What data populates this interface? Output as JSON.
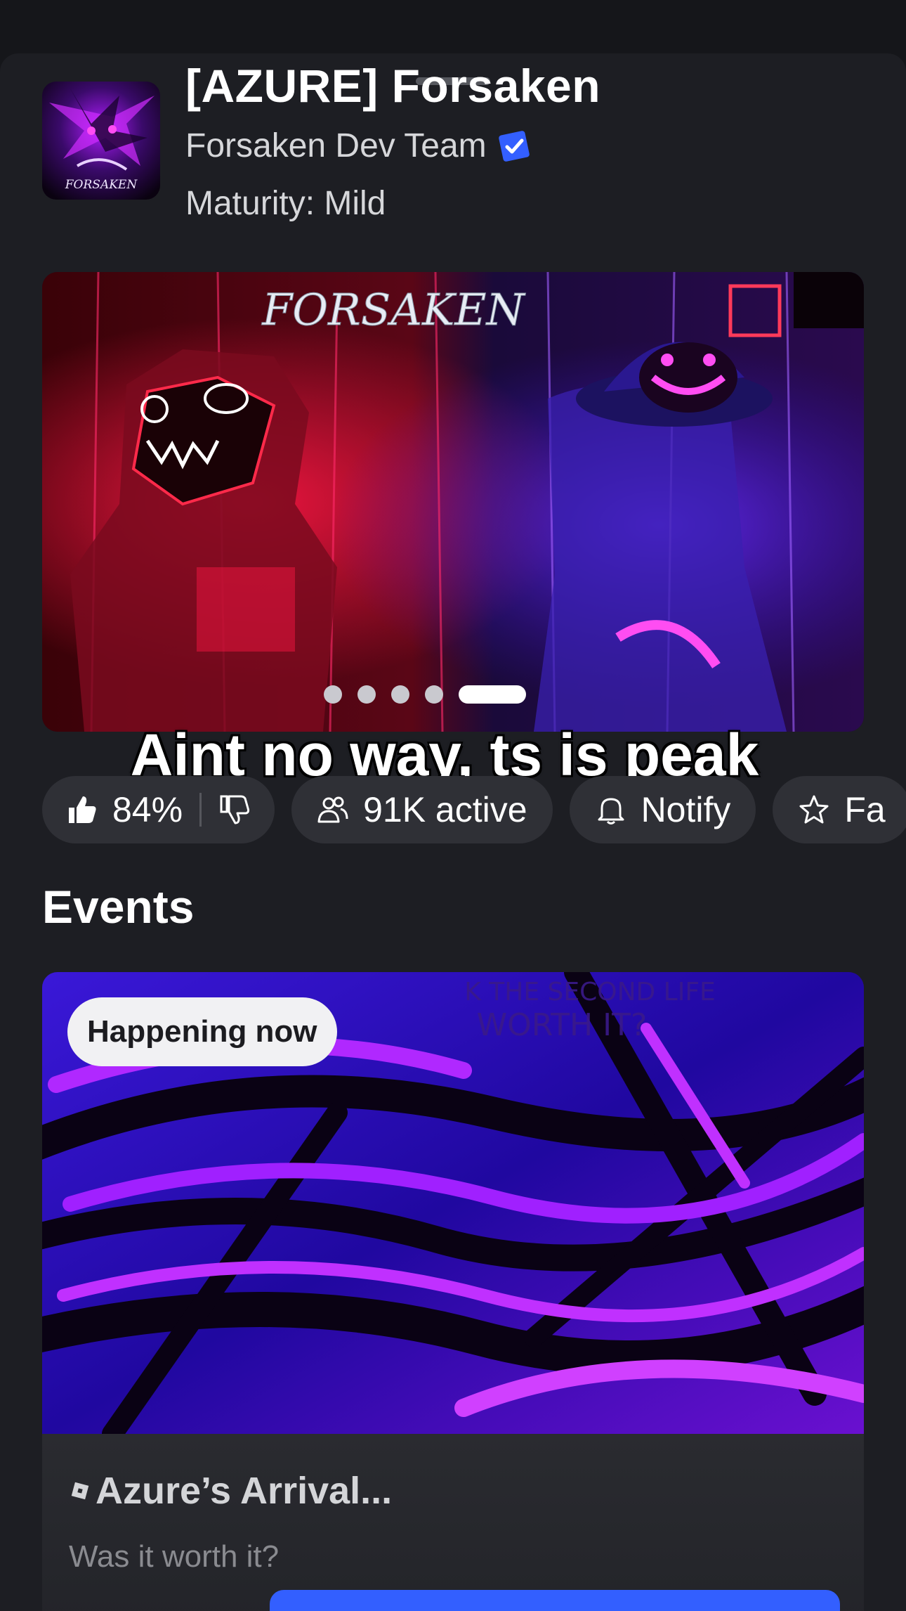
{
  "game": {
    "title": "[AZURE] Forsaken",
    "creator": "Forsaken Dev Team",
    "maturity": "Maturity: Mild",
    "icon_text": "FORSAKEN"
  },
  "carousel": {
    "logo_text": "FORSAKEN",
    "slide_count": 5,
    "active_slide": 5
  },
  "caption": "Aint no way, ts is peak",
  "actions": {
    "rating": "84%",
    "active": "91K active",
    "notify": "Notify",
    "favorite": "Fa"
  },
  "events": {
    "title": "Events",
    "card": {
      "badge": "Happening now",
      "art_text_1": "K THE SECOND LIFE",
      "art_text_2": "WORTH IT?",
      "name": "Azure’s Arrival...",
      "subtitle": "Was it worth it?"
    }
  },
  "colors": {
    "background": "#15161a",
    "sheet": "#1d1e23",
    "pill": "#2f3036",
    "verified": "#335fff",
    "accent_purple": "#8a2cff",
    "accent_red": "#ff1744"
  }
}
